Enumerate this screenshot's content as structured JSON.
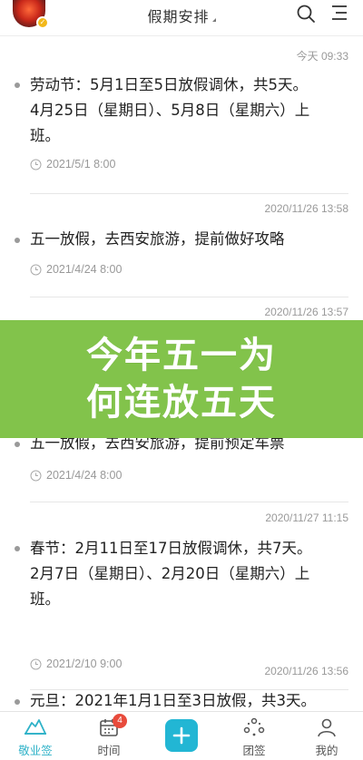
{
  "header": {
    "title": "假期安排",
    "badge_icon": "check-icon"
  },
  "notes": [
    {
      "time": "今天 09:33",
      "lines": [
        "劳动节：5月1日至5日放假调休，共5天。",
        "4月25日（星期日）、5月8日（星期六）上",
        "班。"
      ],
      "remind": "2021/5/1 8:00"
    },
    {
      "time": "2020/11/26 13:58",
      "lines": [
        "五一放假，去西安旅游，提前做好攻略"
      ],
      "remind": "2021/4/24 8:00"
    },
    {
      "time": "2020/11/26 13:57",
      "lines": [
        "五一放假，去西安旅游，提前预定车票"
      ],
      "remind": "2021/4/24 8:00"
    },
    {
      "time": "2020/11/27 11:15",
      "lines": [
        "春节：2月11日至17日放假调休，共7天。",
        "2月7日（星期日）、2月20日（星期六）上",
        "班。"
      ],
      "remind": "2021/2/10 9:00"
    },
    {
      "time": "2020/11/26 13:56",
      "lines": [
        "元旦：2021年1月1日至3日放假，共3天。"
      ]
    }
  ],
  "banner": {
    "line1": "今年五一为",
    "line2": "何连放五天",
    "color": "#82c34b"
  },
  "bottom_nav": {
    "items": [
      {
        "label": "敬业签",
        "icon": "jingyeqian-icon",
        "active": true
      },
      {
        "label": "时间",
        "icon": "calendar-icon",
        "badge": "4"
      },
      {
        "label": "",
        "icon": "add-icon"
      },
      {
        "label": "团签",
        "icon": "team-icon"
      },
      {
        "label": "我的",
        "icon": "user-icon"
      }
    ],
    "accent": "#2fb2c8"
  }
}
